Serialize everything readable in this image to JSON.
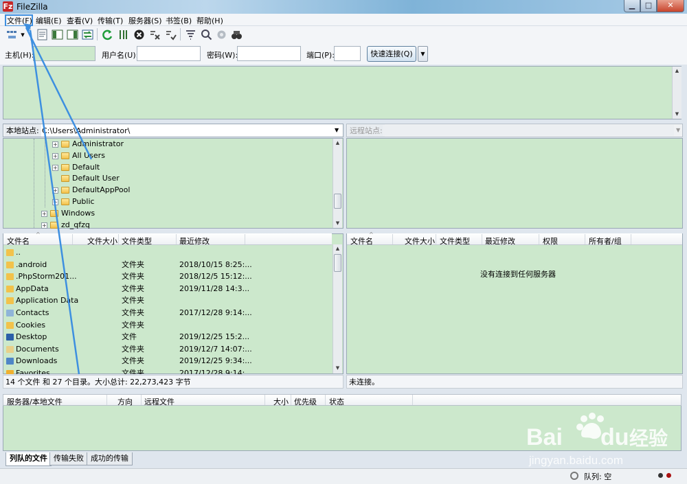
{
  "window": {
    "title": "FileZilla",
    "app_icon": "Fz"
  },
  "menu": [
    "文件(F)",
    "编辑(E)",
    "查看(V)",
    "传输(T)",
    "服务器(S)",
    "书签(B)",
    "帮助(H)"
  ],
  "quickconnect": {
    "host_label": "主机(H):",
    "user_label": "用户名(U):",
    "pass_label": "密码(W):",
    "port_label": "端口(P):",
    "connect_button": "快速连接(Q)"
  },
  "local": {
    "site_label": "本地站点:",
    "path": "C:\\Users\\Administrator\\",
    "tree": [
      {
        "name": "Administrator",
        "expand": true
      },
      {
        "name": "All Users",
        "expand": true
      },
      {
        "name": "Default",
        "expand": true
      },
      {
        "name": "Default User",
        "expand": false
      },
      {
        "name": "DefaultAppPool",
        "expand": true
      },
      {
        "name": "Public",
        "expand": true
      },
      {
        "name": "Windows",
        "expand": true
      },
      {
        "name": "zd_qfzq",
        "expand": true
      }
    ],
    "columns": [
      "文件名",
      "文件大小",
      "文件类型",
      "最近修改"
    ],
    "files": [
      {
        "name": "..",
        "type": "",
        "modified": "",
        "icon": "folder-icon"
      },
      {
        "name": ".android",
        "type": "文件夹",
        "modified": "2018/10/15 8:25:...",
        "icon": "folder-icon"
      },
      {
        "name": ".PhpStorm201...",
        "type": "文件夹",
        "modified": "2018/12/5 15:12:...",
        "icon": "folder-icon"
      },
      {
        "name": "AppData",
        "type": "文件夹",
        "modified": "2019/11/28 14:3...",
        "icon": "folder-icon"
      },
      {
        "name": "Application Data",
        "type": "文件夹",
        "modified": "",
        "icon": "folder-icon"
      },
      {
        "name": "Contacts",
        "type": "文件夹",
        "modified": "2017/12/28 9:14:...",
        "icon": "contacts-folder-icon"
      },
      {
        "name": "Cookies",
        "type": "文件夹",
        "modified": "",
        "icon": "folder-icon"
      },
      {
        "name": "Desktop",
        "type": "文件",
        "modified": "2019/12/25 15:2...",
        "icon": "desktop-icon"
      },
      {
        "name": "Documents",
        "type": "文件夹",
        "modified": "2019/12/7 14:07:...",
        "icon": "documents-folder-icon"
      },
      {
        "name": "Downloads",
        "type": "文件夹",
        "modified": "2019/12/25 9:34:...",
        "icon": "downloads-folder-icon"
      },
      {
        "name": "Favorites",
        "type": "文件夹",
        "modified": "2017/12/28 9:14:...",
        "icon": "favorites-folder-icon"
      }
    ],
    "status": "14 个文件 和 27 个目录。大小总计: 22,273,423 字节"
  },
  "remote": {
    "site_label": "远程站点:",
    "path": "",
    "columns": [
      "文件名",
      "文件大小",
      "文件类型",
      "最近修改",
      "权限",
      "所有者/组"
    ],
    "empty_message": "没有连接到任何服务器",
    "status": "未连接。"
  },
  "queue": {
    "columns": [
      "服务器/本地文件",
      "方向",
      "远程文件",
      "大小",
      "优先级",
      "状态"
    ],
    "tabs": [
      "列队的文件",
      "传输失败",
      "成功的传输"
    ],
    "status": "队列: 空"
  },
  "watermark": {
    "brand": "Bai",
    "brand2": "du",
    "cn": "经验",
    "url": "jingyan.baidu.com"
  },
  "colors": {
    "pane_bg": "#cce8cc",
    "annotation": "#3d8fe0",
    "title_bg": "#9fc3df"
  }
}
